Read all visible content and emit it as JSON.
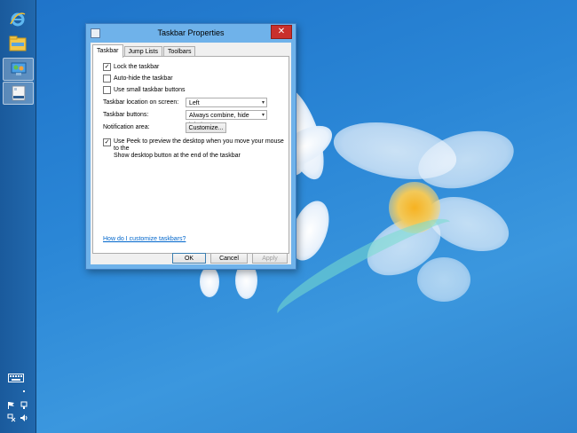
{
  "dialog": {
    "title": "Taskbar Properties",
    "close_symbol": "✕",
    "tabs": [
      {
        "label": "Taskbar",
        "active": true
      },
      {
        "label": "Jump Lists",
        "active": false
      },
      {
        "label": "Toolbars",
        "active": false
      }
    ],
    "options": {
      "lock_taskbar": {
        "label": "Lock the taskbar",
        "checked": true
      },
      "auto_hide": {
        "label": "Auto-hide the taskbar",
        "checked": false
      },
      "small_buttons": {
        "label": "Use small taskbar buttons",
        "checked": false
      }
    },
    "location": {
      "label": "Taskbar location on screen:",
      "value": "Left"
    },
    "buttons_combine": {
      "label": "Taskbar buttons:",
      "value": "Always combine, hide labels"
    },
    "notification": {
      "label": "Notification area:",
      "button": "Customize..."
    },
    "peek": {
      "line1": "Use Peek to preview the desktop when you move your mouse to the",
      "line2": "Show desktop button at the end of the taskbar",
      "checked": true
    },
    "help_link": "How do I customize taskbars?",
    "footer": {
      "ok": "OK",
      "cancel": "Cancel",
      "apply": "Apply"
    }
  },
  "taskbar": {
    "items": [
      {
        "name": "internet-explorer-icon"
      },
      {
        "name": "file-explorer-icon"
      },
      {
        "name": "control-panel-icon"
      },
      {
        "name": "taskbar-properties-icon",
        "active": true
      }
    ],
    "tray": [
      "keyboard-icon",
      "flag-icon",
      "network-icon",
      "volume-icon"
    ]
  },
  "colors": {
    "accent": "#2a86d6",
    "close": "#c9302c",
    "link": "#0066cc"
  }
}
